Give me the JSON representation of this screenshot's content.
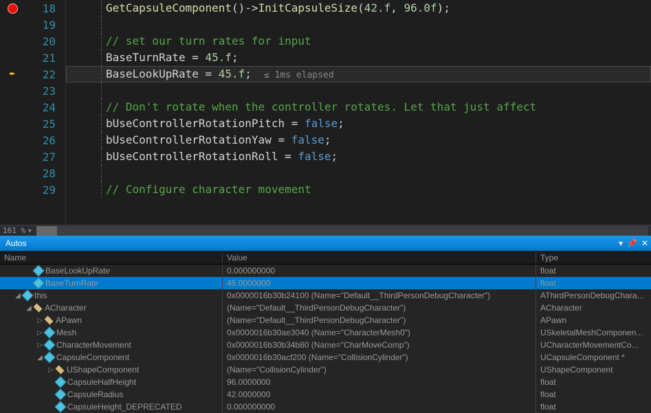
{
  "editor": {
    "zoom": "161 %",
    "lines": [
      {
        "num": "18",
        "marker": "breakpoint",
        "tokens": [
          {
            "t": "GetCapsuleComponent",
            "c": "c-fn"
          },
          {
            "t": "()",
            "c": "c-txt"
          },
          {
            "t": "->",
            "c": "c-txt"
          },
          {
            "t": "InitCapsuleSize",
            "c": "c-fn"
          },
          {
            "t": "(",
            "c": "c-txt"
          },
          {
            "t": "42.f",
            "c": "c-num"
          },
          {
            "t": ", ",
            "c": "c-txt"
          },
          {
            "t": "96.0f",
            "c": "c-num"
          },
          {
            "t": ");",
            "c": "c-txt"
          }
        ]
      },
      {
        "num": "19",
        "tokens": []
      },
      {
        "num": "20",
        "tokens": [
          {
            "t": "// set our turn rates for input",
            "c": "c-cmt"
          }
        ]
      },
      {
        "num": "21",
        "tokens": [
          {
            "t": "BaseTurnRate = ",
            "c": "c-txt"
          },
          {
            "t": "45.f",
            "c": "c-num"
          },
          {
            "t": ";",
            "c": "c-txt"
          }
        ]
      },
      {
        "num": "22",
        "marker": "arrow",
        "current": true,
        "tokens": [
          {
            "t": "BaseLookUpRate = ",
            "c": "c-txt"
          },
          {
            "t": "45.f",
            "c": "c-num"
          },
          {
            "t": ";",
            "c": "c-txt"
          }
        ],
        "perf": "≤ 1ms elapsed"
      },
      {
        "num": "23",
        "tokens": []
      },
      {
        "num": "24",
        "tokens": [
          {
            "t": "// Don't rotate when the controller rotates. Let that just affect",
            "c": "c-cmt"
          }
        ]
      },
      {
        "num": "25",
        "tokens": [
          {
            "t": "bUseControllerRotationPitch = ",
            "c": "c-txt"
          },
          {
            "t": "false",
            "c": "c-kw"
          },
          {
            "t": ";",
            "c": "c-txt"
          }
        ]
      },
      {
        "num": "26",
        "tokens": [
          {
            "t": "bUseControllerRotationYaw = ",
            "c": "c-txt"
          },
          {
            "t": "false",
            "c": "c-kw"
          },
          {
            "t": ";",
            "c": "c-txt"
          }
        ]
      },
      {
        "num": "27",
        "tokens": [
          {
            "t": "bUseControllerRotationRoll = ",
            "c": "c-txt"
          },
          {
            "t": "false",
            "c": "c-kw"
          },
          {
            "t": ";",
            "c": "c-txt"
          }
        ]
      },
      {
        "num": "28",
        "tokens": []
      },
      {
        "num": "29",
        "tokens": [
          {
            "t": "// Configure character movement",
            "c": "c-cmt"
          }
        ]
      }
    ]
  },
  "autos": {
    "title": "Autos",
    "headers": {
      "name": "Name",
      "value": "Value",
      "type": "Type"
    },
    "rows": [
      {
        "depth": 1,
        "icon": "blue",
        "toggle": "",
        "name": "BaseLookUpRate",
        "value": "0.000000000",
        "type": "float"
      },
      {
        "depth": 1,
        "icon": "blue",
        "toggle": "",
        "name": "BaseTurnRate",
        "value": "45.0000000",
        "type": "float",
        "selected": true
      },
      {
        "depth": 0,
        "icon": "blue",
        "toggle": "▢",
        "name": "this",
        "value": "0x0000016b30b24100 (Name=\"Default__ThirdPersonDebugCharacter\")",
        "type": "AThirdPersonDebugChara..."
      },
      {
        "depth": 1,
        "icon": "orange-struct",
        "toggle": "▢",
        "name": "ACharacter",
        "value": "(Name=\"Default__ThirdPersonDebugCharacter\")",
        "type": "ACharacter"
      },
      {
        "depth": 2,
        "icon": "orange-struct",
        "toggle": "▷",
        "name": "APawn",
        "value": "(Name=\"Default__ThirdPersonDebugCharacter\")",
        "type": "APawn"
      },
      {
        "depth": 2,
        "icon": "blue",
        "toggle": "▷",
        "name": "Mesh",
        "value": "0x0000016b30ae3040 (Name=\"CharacterMesh0\")",
        "type": "USkeletalMeshComponen..."
      },
      {
        "depth": 2,
        "icon": "blue",
        "toggle": "▷",
        "name": "CharacterMovement",
        "value": "0x0000016b30b34b80 (Name=\"CharMoveComp\")",
        "type": "UCharacterMovementCo..."
      },
      {
        "depth": 2,
        "icon": "blue",
        "toggle": "▢",
        "name": "CapsuleComponent",
        "value": "0x0000016b30acf200 (Name=\"CollisionCylinder\")",
        "type": "UCapsuleComponent *"
      },
      {
        "depth": 3,
        "icon": "orange-struct",
        "toggle": "▷",
        "name": "UShapeComponent",
        "value": "(Name=\"CollisionCylinder\")",
        "type": "UShapeComponent"
      },
      {
        "depth": 3,
        "icon": "blue",
        "toggle": "",
        "name": "CapsuleHalfHeight",
        "value": "96.0000000",
        "type": "float"
      },
      {
        "depth": 3,
        "icon": "blue",
        "toggle": "",
        "name": "CapsuleRadius",
        "value": "42.0000000",
        "type": "float"
      },
      {
        "depth": 3,
        "icon": "blue",
        "toggle": "",
        "name": "CapsuleHeight_DEPRECATED",
        "value": "0.000000000",
        "type": "float"
      }
    ]
  }
}
